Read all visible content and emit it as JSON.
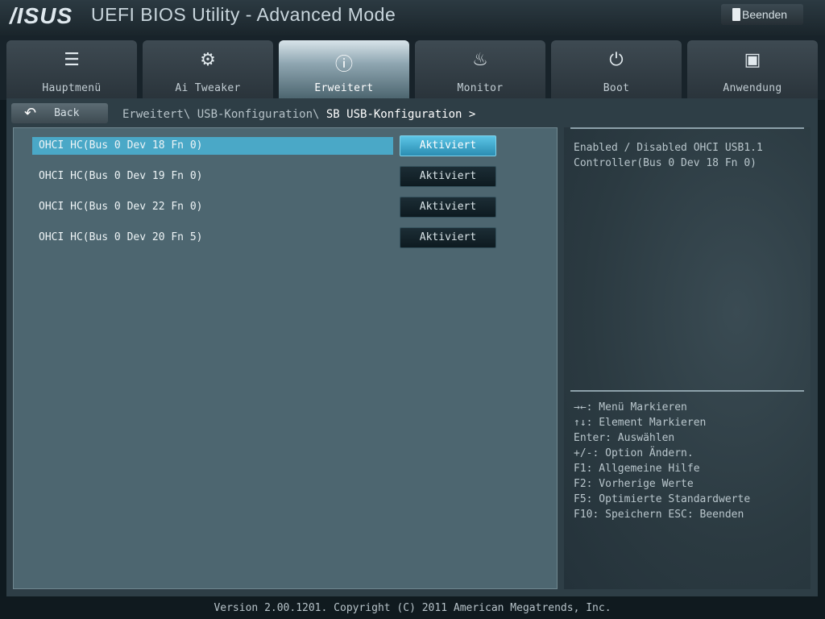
{
  "header": {
    "logo_text": "/ISUS",
    "title": "UEFI BIOS Utility - Advanced Mode",
    "exit_label": "Beenden"
  },
  "tabs": [
    {
      "label": "Hauptmenü",
      "icon": "list-icon"
    },
    {
      "label": "Ai Tweaker",
      "icon": "tweaker-icon"
    },
    {
      "label": "Erweitert",
      "icon": "advanced-icon",
      "active": true
    },
    {
      "label": "Monitor",
      "icon": "monitor-icon"
    },
    {
      "label": "Boot",
      "icon": "power-icon"
    },
    {
      "label": "Anwendung",
      "icon": "toolbox-icon"
    }
  ],
  "nav": {
    "back_label": "Back",
    "breadcrumb_path": "Erweitert\\ USB-Konfiguration\\",
    "breadcrumb_current": "SB USB-Konfiguration >"
  },
  "settings": [
    {
      "label": "OHCI HC(Bus 0 Dev 18 Fn 0)",
      "value": "Aktiviert",
      "selected": true
    },
    {
      "label": "OHCI HC(Bus 0 Dev 19 Fn 0)",
      "value": "Aktiviert"
    },
    {
      "label": "OHCI HC(Bus 0 Dev 22 Fn 0)",
      "value": "Aktiviert"
    },
    {
      "label": "OHCI HC(Bus 0 Dev 20 Fn 5)",
      "value": "Aktiviert"
    }
  ],
  "help": {
    "description": "Enabled / Disabled OHCI USB1.1 Controller(Bus 0 Dev 18 Fn 0)",
    "keys": [
      "→←: Menü Markieren",
      "↑↓: Element Markieren",
      "Enter: Auswählen",
      "+/-: Option Ändern.",
      "F1: Allgemeine Hilfe",
      "F2: Vorherige Werte",
      "F5: Optimierte Standardwerte",
      "F10: Speichern  ESC: Beenden"
    ]
  },
  "footer": {
    "version": "Version 2.00.1201. Copyright (C) 2011 American Megatrends, Inc."
  },
  "colors": {
    "accent": "#4aa8c7",
    "panel": "#4d6670",
    "background": "#0f1a1f"
  }
}
